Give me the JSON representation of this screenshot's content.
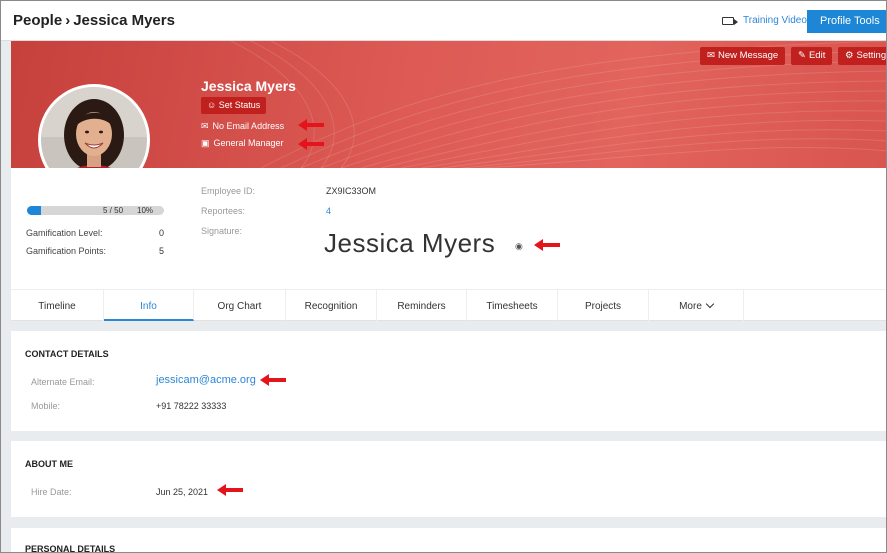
{
  "header": {
    "breadcrumb_root": "People",
    "breadcrumb_separator": "›",
    "breadcrumb_current": "Jessica Myers",
    "training_video": "Training Video",
    "profile_tools": "Profile Tools"
  },
  "banner": {
    "new_message": "New Message",
    "edit": "Edit",
    "settings": "Settings",
    "name": "Jessica Myers",
    "set_status": "Set Status",
    "email": "No Email Address",
    "job_title": "General Manager"
  },
  "summary": {
    "progress_text": "5 / 50",
    "progress_percent": "10%",
    "progress_fraction": 0.1,
    "gamification_level_label": "Gamification Level:",
    "gamification_level": "0",
    "gamification_points_label": "Gamification Points:",
    "gamification_points": "5",
    "employee_id_label": "Employee ID:",
    "employee_id": "ZX9IC33OM",
    "reportees_label": "Reportees:",
    "reportees": "4",
    "signature_label": "Signature:",
    "signature": "Jessica Myers"
  },
  "tabs": [
    {
      "label": "Timeline"
    },
    {
      "label": "Info"
    },
    {
      "label": "Org Chart"
    },
    {
      "label": "Recognition"
    },
    {
      "label": "Reminders"
    },
    {
      "label": "Timesheets"
    },
    {
      "label": "Projects"
    },
    {
      "label": "More"
    }
  ],
  "active_tab": "Info",
  "contact": {
    "title": "CONTACT DETAILS",
    "alt_email_label": "Alternate Email:",
    "alt_email": "jessicam@acme.org",
    "mobile_label": "Mobile:",
    "mobile": "+91 78222 33333"
  },
  "about": {
    "title": "ABOUT ME",
    "hire_date_label": "Hire Date:",
    "hire_date": "Jun 25, 2021"
  },
  "personal": {
    "title": "PERSONAL DETAILS"
  },
  "colors": {
    "accent": "#1d86d6",
    "banner": "#dd5a55",
    "button_red": "#c0201e",
    "annotation_arrow": "#e3141b"
  }
}
